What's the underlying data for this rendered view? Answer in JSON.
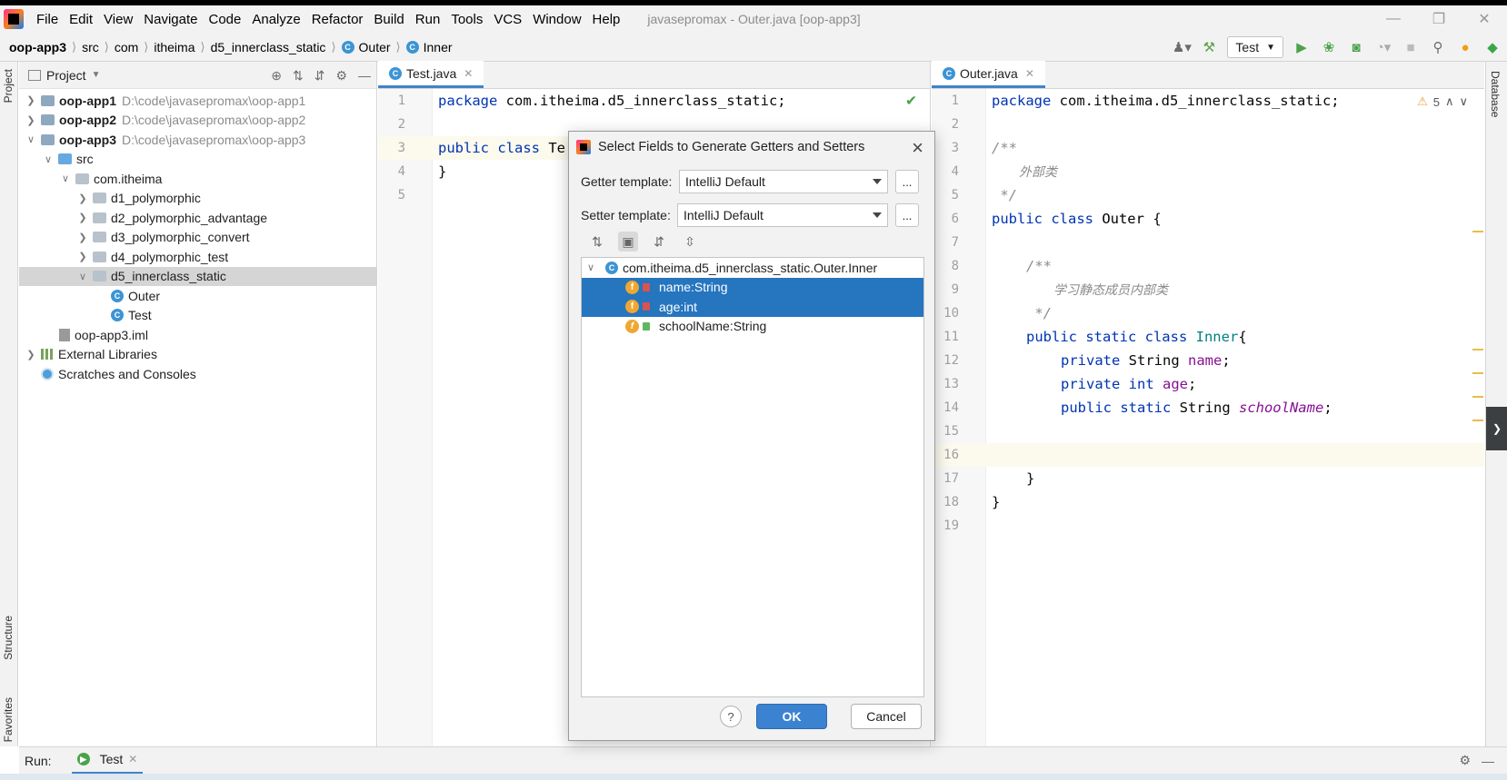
{
  "window": {
    "title": "javasepromax - Outer.java [oop-app3]",
    "menu": [
      "File",
      "Edit",
      "View",
      "Navigate",
      "Code",
      "Analyze",
      "Refactor",
      "Build",
      "Run",
      "Tools",
      "VCS",
      "Window",
      "Help"
    ]
  },
  "breadcrumb": [
    "oop-app3",
    "src",
    "com",
    "itheima",
    "d5_innerclass_static",
    "Outer",
    "Inner"
  ],
  "toolbar": {
    "run_config": "Test"
  },
  "side_tabs": {
    "project": "Project",
    "structure": "Structure",
    "favorites": "Favorites",
    "database": "Database"
  },
  "project_panel": {
    "title": "Project",
    "tree": [
      {
        "label": "oop-app1",
        "path": "D:\\code\\javasepromax\\oop-app1"
      },
      {
        "label": "oop-app2",
        "path": "D:\\code\\javasepromax\\oop-app2"
      },
      {
        "label": "oop-app3",
        "path": "D:\\code\\javasepromax\\oop-app3"
      },
      {
        "label": "src"
      },
      {
        "label": "com.itheima"
      },
      {
        "label": "d1_polymorphic"
      },
      {
        "label": "d2_polymorphic_advantage"
      },
      {
        "label": "d3_polymorphic_convert"
      },
      {
        "label": "d4_polymorphic_test"
      },
      {
        "label": "d5_innerclass_static"
      },
      {
        "label": "Outer"
      },
      {
        "label": "Test"
      },
      {
        "label": "oop-app3.iml"
      },
      {
        "label": "External Libraries"
      },
      {
        "label": "Scratches and Consoles"
      }
    ]
  },
  "editor_left": {
    "tab": "Test.java",
    "lines": [
      {
        "num": "1",
        "text": "package com.itheima.d5_innerclass_static;"
      },
      {
        "num": "2",
        "text": ""
      },
      {
        "num": "3",
        "kw": "public class ",
        "rest": "Te"
      },
      {
        "num": "4",
        "text": "}"
      },
      {
        "num": "5",
        "text": ""
      }
    ]
  },
  "editor_right": {
    "tab": "Outer.java",
    "warnings": "5",
    "lines": [
      {
        "num": "1"
      },
      {
        "num": "2"
      },
      {
        "num": "3"
      },
      {
        "num": "4"
      },
      {
        "num": "5"
      },
      {
        "num": "6"
      },
      {
        "num": "7"
      },
      {
        "num": "8"
      },
      {
        "num": "9"
      },
      {
        "num": "10"
      },
      {
        "num": "11"
      },
      {
        "num": "12"
      },
      {
        "num": "13"
      },
      {
        "num": "14"
      },
      {
        "num": "15"
      },
      {
        "num": "16"
      },
      {
        "num": "17"
      },
      {
        "num": "18"
      },
      {
        "num": "19"
      }
    ],
    "code": {
      "l1_kw": "package",
      "l1_rest": " com.itheima.d5_innerclass_static;",
      "l3": "/**",
      "l4": "外部类",
      "l5": " */",
      "l6_kw": "public class",
      "l6_cls": " Outer",
      "l6_rest": " {",
      "l8": "/**",
      "l9": "学习静态成员内部类",
      "l10": " */",
      "l11_kw": "public static class",
      "l11_cls": " Inner",
      "l11_rest": "{",
      "l12_kw": "private",
      "l12_type": " String ",
      "l12_field": "name",
      "l12_end": ";",
      "l13_kw": "private int",
      "l13_field": " age",
      "l13_end": ";",
      "l14_kw": "public static",
      "l14_type": " String ",
      "l14_field": "schoolName",
      "l14_end": ";",
      "l17": "}",
      "l18": "}"
    }
  },
  "dialog": {
    "title": "Select Fields to Generate Getters and Setters",
    "getter_label": "Getter template:",
    "getter_value": "IntelliJ Default",
    "setter_label": "Setter template:",
    "setter_value": "IntelliJ Default",
    "more_label": "...",
    "root_class": "com.itheima.d5_innerclass_static.Outer.Inner",
    "fields": [
      {
        "label": "name:String",
        "selected": true
      },
      {
        "label": "age:int",
        "selected": true
      },
      {
        "label": "schoolName:String",
        "selected": false
      }
    ],
    "help_label": "?",
    "ok_label": "OK",
    "cancel_label": "Cancel"
  },
  "run_bar": {
    "label": "Run:",
    "tab": "Test"
  },
  "colors": {
    "selection": "#2675bf",
    "primary_button": "#3b82d0",
    "keyword": "#0033b3",
    "comment": "#8c8c8c",
    "field": "#871094"
  }
}
